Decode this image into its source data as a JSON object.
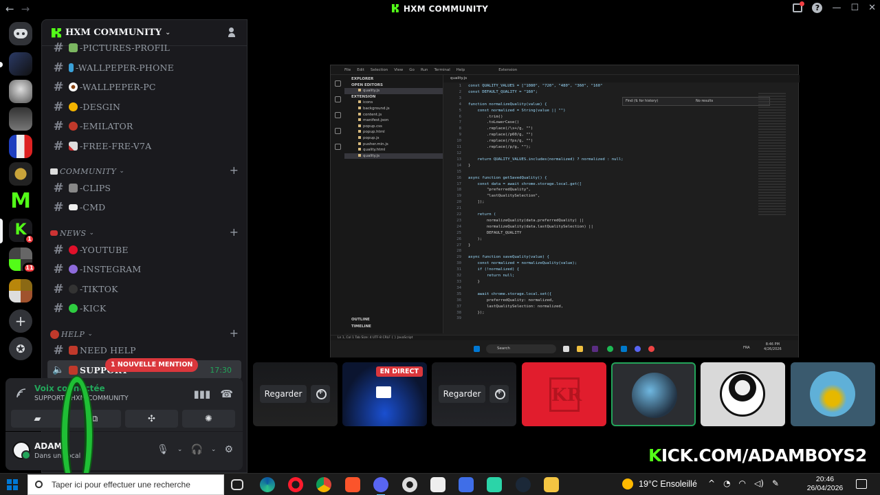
{
  "window": {
    "title": "HXM COMMUNITY",
    "back_glyph": "←",
    "forward_glyph": "→",
    "minimize_glyph": "—",
    "maximize_glyph": "☐",
    "close_glyph": "✕"
  },
  "server_rail": {
    "mention_badge_1": "1",
    "mention_badge_2": "11",
    "add_glyph": "+",
    "discover_glyph": "✪"
  },
  "guild": {
    "name": "HXM COMMUNITY",
    "chevron": "⌄"
  },
  "channels": {
    "pictures_profil": "-PICTURES-PROFIL",
    "wallpeper_phone": "-WALLPEPER-PHONE",
    "wallpeper_pc": "-WALLPEPER-PC",
    "desgin": "-DESGIN",
    "emilator": "-EMILATOR",
    "free_fre": "-FREE-FRE-V7A",
    "clips": "-CLIPS",
    "cmd": "-CMD",
    "youtube": "-YOUTUBE",
    "instegram": "-INSTEGRAM",
    "tiktok": "-TIKTOK",
    "kick": "-KICK",
    "need_help": "NEED HELP",
    "support": "SUPPORT"
  },
  "categories": {
    "community": "COMMUNITY",
    "news": "NEWS",
    "help": "HELP"
  },
  "support_time": "17:30",
  "mention_banner": "1 NOUVELLE MENTION",
  "voice": {
    "status": "Voix connectée",
    "channel": "SUPPORT / HXM COMMUNITY"
  },
  "user": {
    "name": "ADAM",
    "status": "Dans un vocal"
  },
  "stage": {
    "watch_label": "Regarder",
    "live_label": "EN DIRECT",
    "kick_brand": "K",
    "kick_url_rest": "ICK.COM/ADAMBOYS2"
  },
  "vscode": {
    "tab": "quality.js",
    "menu": [
      "File",
      "Edit",
      "Selection",
      "View",
      "Go",
      "Run",
      "Terminal",
      "Help"
    ],
    "search": "Extension",
    "explorer_title": "EXPLORER",
    "open_editors": "OPEN EDITORS",
    "open_file": "quality.js",
    "folder": "EXTENSION",
    "files": [
      "icons",
      "background.js",
      "content.js",
      "manifest.json",
      "popup.css",
      "popup.html",
      "popup.js",
      "pusher.min.js",
      "quality.html",
      "quality.js"
    ],
    "outline": "OUTLINE",
    "timeline": "TIMELINE",
    "find_placeholder": "Find (⇅ for history)",
    "find_result": "No results",
    "status": "Ln 1, Col 1   Tab Size: 4   UTF-8   CRLF   { } JavaScript",
    "taskbar_search": "Search",
    "taskbar_lang": "FRA",
    "taskbar_time": "8:46 PM",
    "taskbar_date": "4/26/2026",
    "code": [
      "const QUALITY_VALUES = [\"1080\", \"720\", \"480\", \"360\", \"160\"",
      "const DEFAULT_QUALITY = \"160\";",
      "",
      "function normalizeQuality(value) {",
      "    const normalized = String(value || \"\")",
      "        .trim()",
      "        .toLowerCase()",
      "        .replace(/\\s+/g, \"\")",
      "        .replace(/p60/g, \"\")",
      "        .replace(/fps/g, \"\")",
      "        .replace(/p/g, \"\");",
      "",
      "    return QUALITY_VALUES.includes(normalized) ? normalized : null;",
      "}",
      "",
      "async function getSavedQuality() {",
      "    const data = await chrome.storage.local.get([",
      "        \"preferredQuality\",",
      "        \"lastQualitySelection\",",
      "    ]);",
      "",
      "    return (",
      "        normalizeQuality(data.preferredQuality) ||",
      "        normalizeQuality(data.lastQualitySelection) ||",
      "        DEFAULT_QUALITY",
      "    );",
      "}",
      "",
      "async function saveQuality(value) {",
      "    const normalized = normalizeQuality(value);",
      "    if (!normalized) {",
      "        return null;",
      "    }",
      "",
      "    await chrome.storage.local.set({",
      "        preferredQuality: normalized,",
      "        lastQualitySelection: normalized,",
      "    });",
      ""
    ]
  },
  "taskbar": {
    "search_placeholder": "Taper ici pour effectuer une recherche",
    "weather": "19°C  Ensoleillé",
    "time": "20:46",
    "date": "26/04/2026"
  },
  "colors": {
    "kick_green": "#53fc18",
    "live_red": "#da373c",
    "online_green": "#23a55a"
  }
}
